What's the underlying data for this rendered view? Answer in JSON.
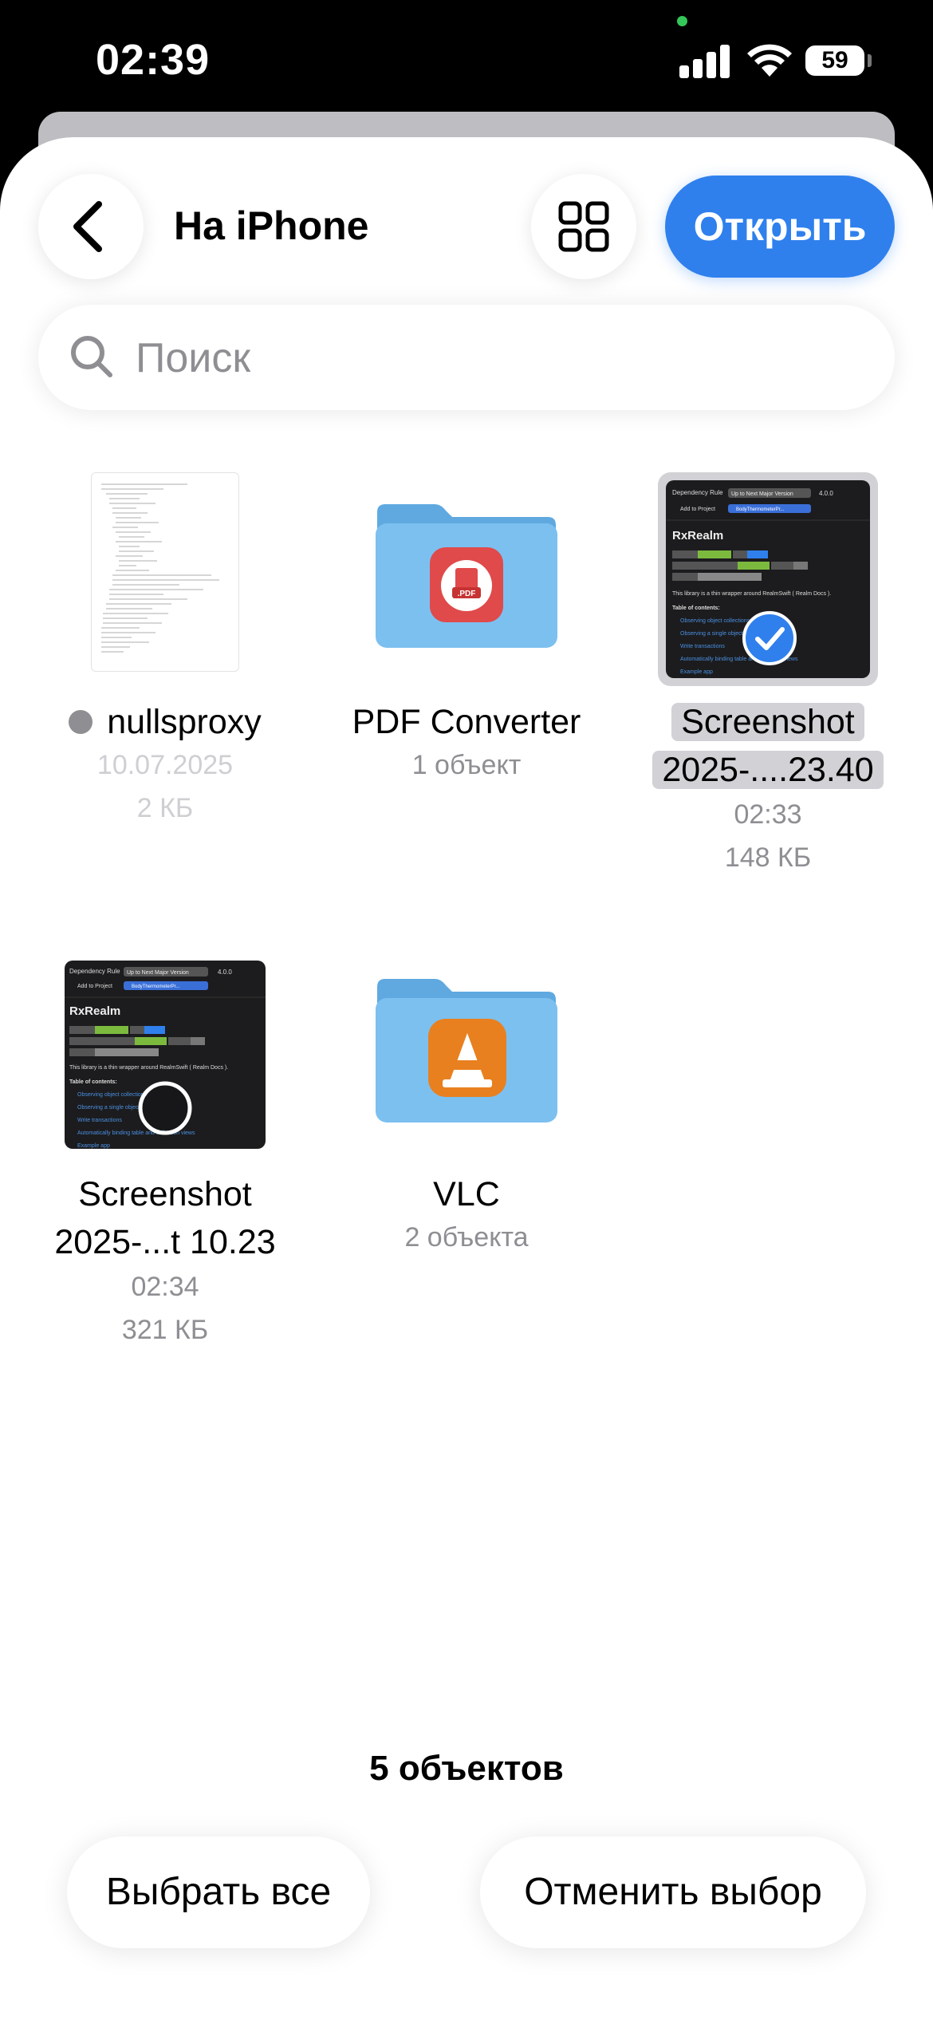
{
  "status_bar": {
    "time": "02:39",
    "battery": "59"
  },
  "nav": {
    "title": "На iPhone",
    "open_label": "Открыть"
  },
  "search": {
    "placeholder": "Поиск"
  },
  "files": [
    {
      "name": "nullsproxy",
      "date": "10.07.2025",
      "size": "2 КБ"
    },
    {
      "name": "PDF Converter",
      "info": "1 объект"
    },
    {
      "name_line1": "Screenshot",
      "name_line2": "2025-....23.40",
      "time": "02:33",
      "size": "148 КБ",
      "selected": true
    },
    {
      "name_line1": "Screenshot",
      "name_line2": "2025-...t 10.23",
      "time": "02:34",
      "size": "321 КБ",
      "selected": false
    },
    {
      "name": "VLC",
      "info": "2 объекта"
    }
  ],
  "thumbnail_text": {
    "dependency_rule": "Dependency Rule",
    "rule_value": "Up to Next Major Version",
    "version": "4.0.0",
    "add_to_project": "Add to Project",
    "project": "BodyThermometerPr...",
    "heading": "RxRealm",
    "carthage": "Carthage",
    "compatible": "compatible",
    "pod": "pod",
    "pod_version": "v5.0.4",
    "spm": "Swift Package Manager",
    "license": "license",
    "mit": "MIT",
    "platform": "platform",
    "platforms": "ios | tvos | macos | watchos",
    "desc": "This library is a thin wrapper around RealmSwift ( Realm Docs ).",
    "toc": "Table of contents:",
    "toc_items": [
      "Observing object collections",
      "Observing a single object",
      "Write transactions",
      "Automatically binding table and collection views",
      "Example app"
    ]
  },
  "footer": {
    "count": "5 объектов",
    "select_all": "Выбрать все",
    "deselect": "Отменить выбор"
  },
  "colors": {
    "accent": "#2f80ed",
    "folder": "#7cc0f0"
  }
}
